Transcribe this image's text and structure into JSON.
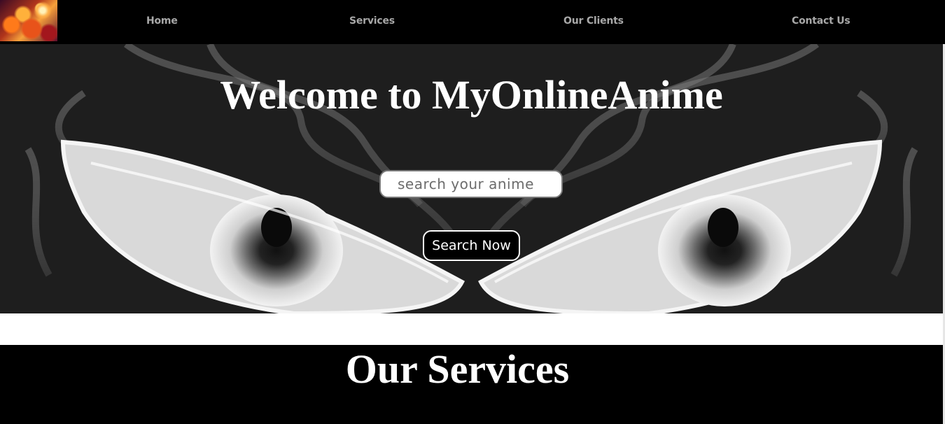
{
  "navbar": {
    "logo_icon": "anime-character-logo",
    "links": [
      {
        "label": "Home"
      },
      {
        "label": "Services"
      },
      {
        "label": "Our Clients"
      },
      {
        "label": "Contact Us"
      }
    ]
  },
  "hero": {
    "title": "Welcome to MyOnlineAnime",
    "search_placeholder": "search your anime",
    "search_button": "Search Now"
  },
  "services": {
    "title": "Our Services"
  },
  "colors": {
    "nav_bg": "#000000",
    "nav_text": "#a8a8a8",
    "hero_bg": "#1f1f1f",
    "accent_white": "#ffffff"
  }
}
